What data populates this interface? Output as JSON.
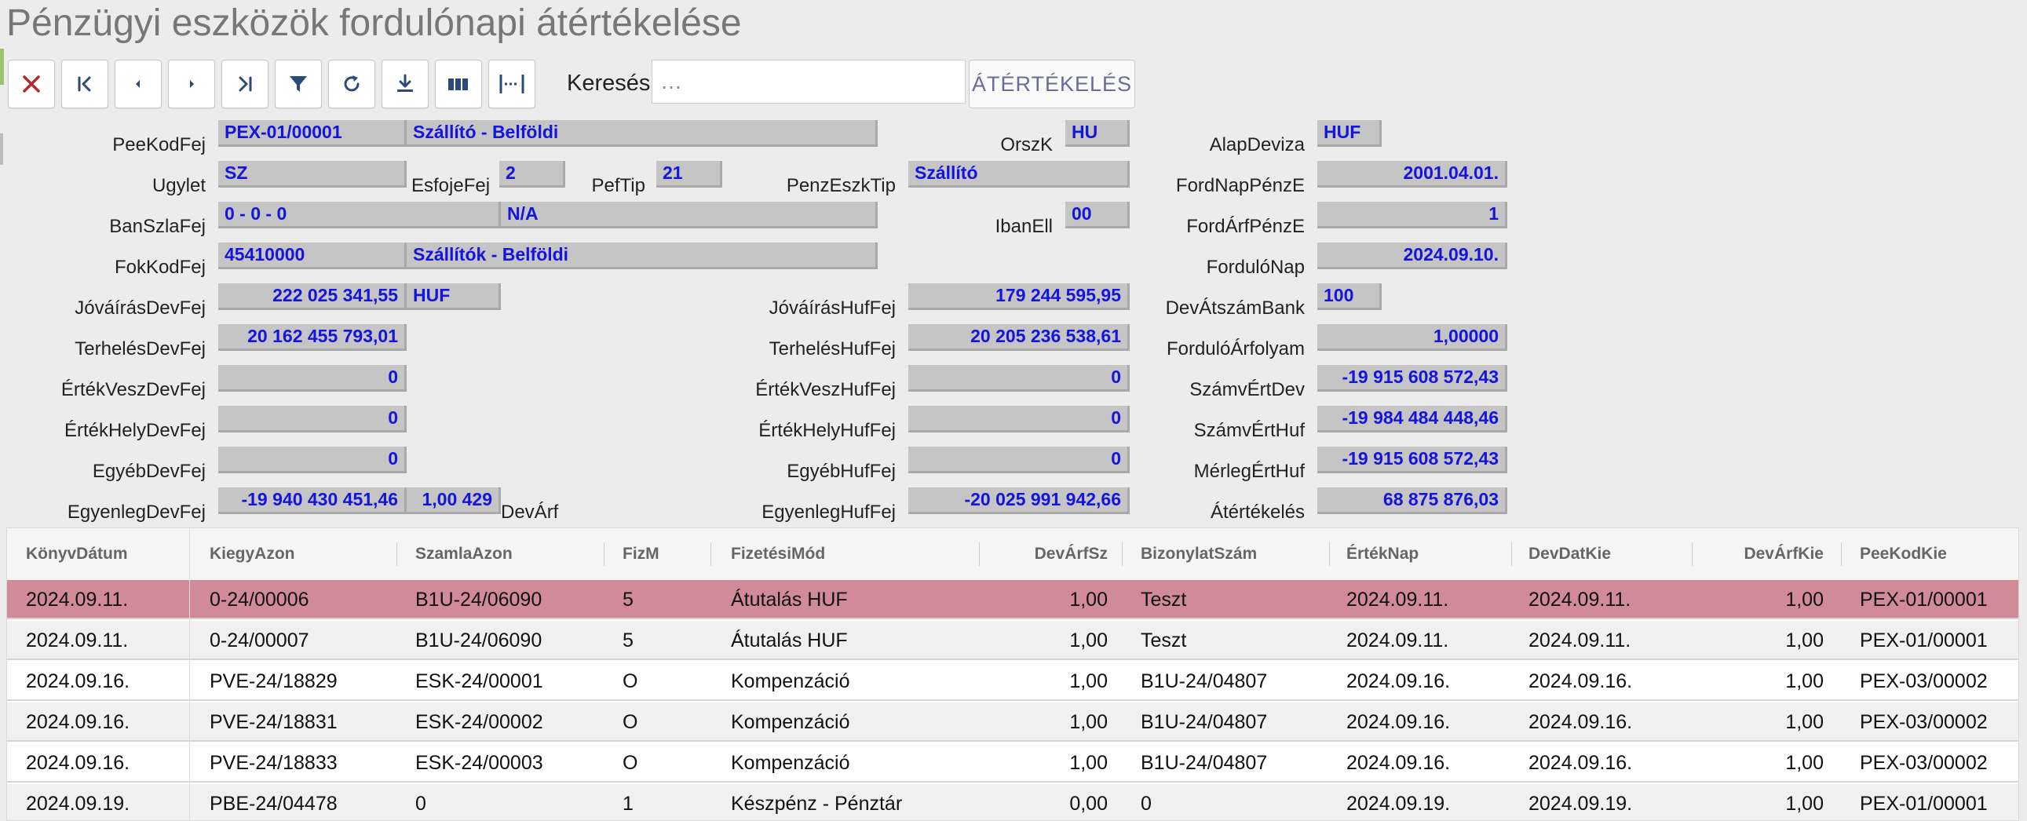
{
  "title": "Pénzügyi eszközök fordulónapi átértékelése",
  "toolbar": {
    "search_label": "Keresés:",
    "search_placeholder": "…",
    "action_label": "ÁTÉRTÉKELÉS"
  },
  "form": {
    "PeeKodFej": {
      "label": "PeeKodFej",
      "code": "PEX-01/00001",
      "name": "Szállító - Belföldi"
    },
    "OrszK": {
      "label": "OrszK",
      "value": "HU"
    },
    "AlapDeviza": {
      "label": "AlapDeviza",
      "value": "HUF"
    },
    "Ugylet": {
      "label": "Ugylet",
      "value": "SZ"
    },
    "EsfojeFej": {
      "label": "EsfojeFej",
      "value": "2"
    },
    "PefTip": {
      "label": "PefTip",
      "value": "21"
    },
    "PenzEszkTip": {
      "label": "PenzEszkTip",
      "value": "Szállító"
    },
    "FordNapPenzE": {
      "label": "FordNapPénzE",
      "value": "2001.04.01."
    },
    "BanSzlaFej": {
      "label": "BanSzlaFej",
      "account": "0 - 0 - 0",
      "name": "N/A"
    },
    "IbanEll": {
      "label": "IbanEll",
      "value": "00"
    },
    "FordArfPenzE": {
      "label": "FordÁrfPénzE",
      "value": "1"
    },
    "FokKodFej": {
      "label": "FokKodFej",
      "code": "45410000",
      "name": "Szállítók - Belföldi"
    },
    "ForduloNap": {
      "label": "FordulóNap",
      "value": "2024.09.10."
    },
    "JovairasDevFej": {
      "label": "JóváírásDevFej",
      "value": "222 025 341,55",
      "currency": "HUF"
    },
    "JovairasHufFej": {
      "label": "JóváírásHufFej",
      "value": "179 244 595,95"
    },
    "DevAtszamBank": {
      "label": "DevÁtszámBank",
      "value": "100"
    },
    "TerhelesDevFej": {
      "label": "TerhelésDevFej",
      "value": "20 162 455 793,01"
    },
    "TerhelesHufFej": {
      "label": "TerhelésHufFej",
      "value": "20 205 236 538,61"
    },
    "ForduloArfolyam": {
      "label": "FordulóÁrfolyam",
      "value": "1,00000"
    },
    "ErtekVeszDevFej": {
      "label": "ÉrtékVeszDevFej",
      "value": "0"
    },
    "ErtekVeszHufFej": {
      "label": "ÉrtékVeszHufFej",
      "value": "0"
    },
    "SzamvErtDev": {
      "label": "SzámvÉrtDev",
      "value": "-19 915 608 572,43"
    },
    "ErtekHelyDevFej": {
      "label": "ÉrtékHelyDevFej",
      "value": "0"
    },
    "ErtekHelyHufFej": {
      "label": "ÉrtékHelyHufFej",
      "value": "0"
    },
    "SzamvErtHuf": {
      "label": "SzámvÉrtHuf",
      "value": "-19 984 484 448,46"
    },
    "EgyebDevFej": {
      "label": "EgyébDevFej",
      "value": "0"
    },
    "EgyebHufFej": {
      "label": "EgyébHufFej",
      "value": "0"
    },
    "MerlegErtHuf": {
      "label": "MérlegÉrtHuf",
      "value": "-19 915 608 572,43"
    },
    "EgyenlegDevFej": {
      "label": "EgyenlegDevFej",
      "value": "-19 940 430 451,46",
      "devarf": "1,00 429",
      "devarf_label": "DevÁrf"
    },
    "EgyenlegHufFej": {
      "label": "EgyenlegHufFej",
      "value": "-20 025 991 942,66"
    },
    "Atertekeles": {
      "label": "Átértékelés",
      "value": "68 875 876,03"
    }
  },
  "grid": {
    "columns": [
      "KönyvDátum",
      "KiegyAzon",
      "SzamlaAzon",
      "FizM",
      "FizetésiMód",
      "DevÁrfSz",
      "BizonylatSzám",
      "ÉrtékNap",
      "DevDatKie",
      "DevÁrfKie",
      "PeeKodKie"
    ],
    "rows": [
      [
        "2024.09.11.",
        "0-24/00006",
        "B1U-24/06090",
        "5",
        "Átutalás HUF",
        "1,00",
        "Teszt",
        "2024.09.11.",
        "2024.09.11.",
        "1,00",
        "PEX-01/00001"
      ],
      [
        "2024.09.11.",
        "0-24/00007",
        "B1U-24/06090",
        "5",
        "Átutalás HUF",
        "1,00",
        "Teszt",
        "2024.09.11.",
        "2024.09.11.",
        "1,00",
        "PEX-01/00001"
      ],
      [
        "2024.09.16.",
        "PVE-24/18829",
        "ESK-24/00001",
        "O",
        "Kompenzáció",
        "1,00",
        "B1U-24/04807",
        "2024.09.16.",
        "2024.09.16.",
        "1,00",
        "PEX-03/00002"
      ],
      [
        "2024.09.16.",
        "PVE-24/18831",
        "ESK-24/00002",
        "O",
        "Kompenzáció",
        "1,00",
        "B1U-24/04807",
        "2024.09.16.",
        "2024.09.16.",
        "1,00",
        "PEX-03/00002"
      ],
      [
        "2024.09.16.",
        "PVE-24/18833",
        "ESK-24/00003",
        "O",
        "Kompenzáció",
        "1,00",
        "B1U-24/04807",
        "2024.09.16.",
        "2024.09.16.",
        "1,00",
        "PEX-03/00002"
      ],
      [
        "2024.09.19.",
        "PBE-24/04478",
        "0",
        "1",
        "Készpénz - Pénztár",
        "0,00",
        "0",
        "2024.09.19.",
        "2024.09.19.",
        "1,00",
        "PEX-01/00001"
      ]
    ]
  }
}
